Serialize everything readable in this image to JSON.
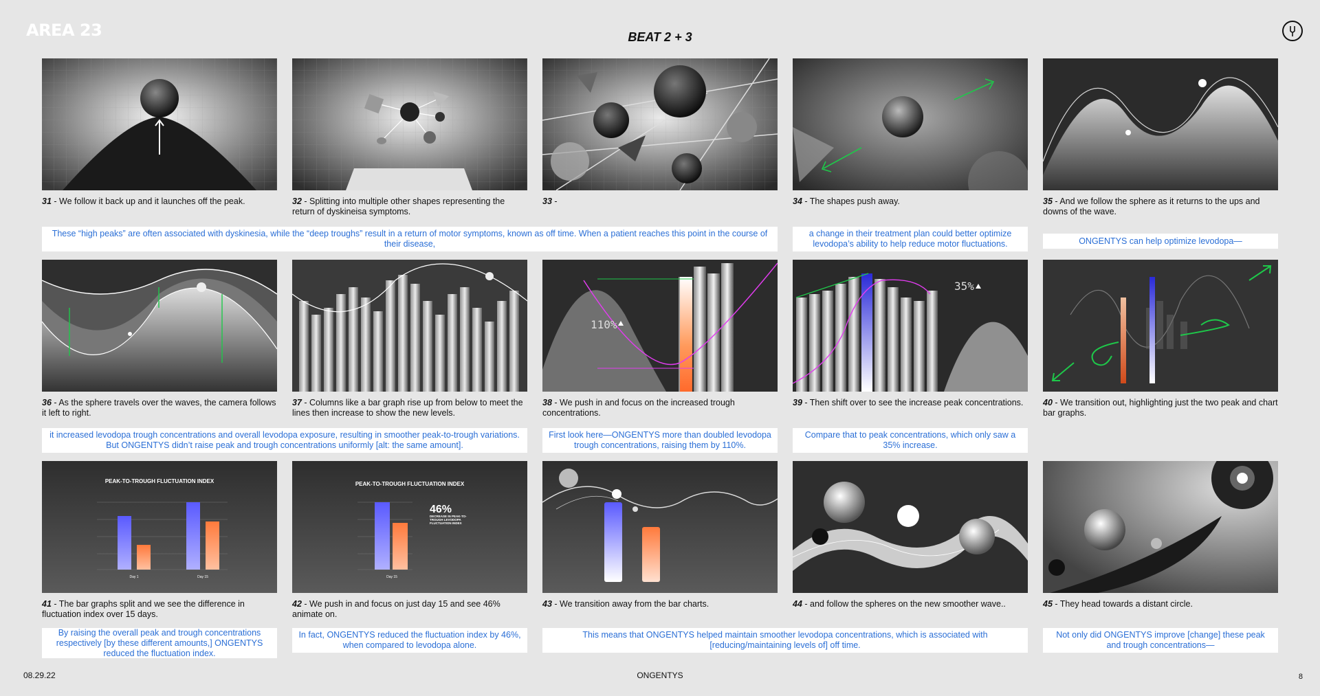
{
  "header": {
    "logo": "AREA 23",
    "title": "BEAT 2 + 3",
    "brandmark_icon": "tuning-fork-icon"
  },
  "colors": {
    "background": "#e6e6e6",
    "vo_text": "#2b6fd6",
    "accent_green": "#1ec94a",
    "accent_orange": "#ff7a3c",
    "accent_blue": "#2a2ad8",
    "accent_magenta": "#e23cf0"
  },
  "frames": [
    {
      "num": "31",
      "caption": "We follow it back up and it launches off the peak."
    },
    {
      "num": "32",
      "caption": "Splitting into multiple other shapes representing the return of dyskineisa symptoms."
    },
    {
      "num": "33",
      "caption": ""
    },
    {
      "num": "34",
      "caption": "The shapes push away."
    },
    {
      "num": "35",
      "caption": "And we follow the sphere as it returns to the ups and downs of the wave."
    },
    {
      "num": "36",
      "caption": "As the sphere travels over the waves, the camera follows it left to right."
    },
    {
      "num": "37",
      "caption": "Columns like a bar graph rise up from below to meet the lines then increase to show the new levels."
    },
    {
      "num": "38",
      "caption": "We push in and focus on the increased trough concentrations.",
      "overlay": "110%"
    },
    {
      "num": "39",
      "caption": "Then shift over to see the increase peak concentrations.",
      "overlay": "35%"
    },
    {
      "num": "40",
      "caption": "We transition out, highlighting just the two peak and chart bar graphs."
    },
    {
      "num": "41",
      "caption": "The bar graphs split and we see the difference in fluctuation index over 15 days.",
      "chart_title": "PEAK-TO-TROUGH FLUCTUATION INDEX",
      "chart_labels": [
        "Day 1",
        "Day 15"
      ]
    },
    {
      "num": "42",
      "caption": "We push in and focus on just day 15 and see 46% animate on.",
      "chart_title": "PEAK-TO-TROUGH FLUCTUATION INDEX",
      "big_number": "46%",
      "big_label": "DECREASE IN PEAK-TO-TROUGH LEVODOPA FLUCTUATION INDEX",
      "chart_labels": [
        "Day 15"
      ]
    },
    {
      "num": "43",
      "caption": "We transition away from the bar charts."
    },
    {
      "num": "44",
      "caption": "and follow the spheres on the new smoother wave.."
    },
    {
      "num": "45",
      "caption": "They head towards a distant circle."
    }
  ],
  "voiceovers": [
    "These “high peaks” are often associated with dyskinesia, while the “deep troughs” result in a return of motor symptoms, known as off time. When a patient reaches this point in the course of their disease,",
    "a change in their treatment plan could better optimize levodopa’s ability to help reduce motor fluctuations.",
    "ONGENTYS can help optimize levodopa—",
    "it increased levodopa trough concentrations and overall levodopa exposure, resulting in smoother peak-to-trough variations. But ONGENTYS didn’t raise peak and trough concentrations uniformly [alt: the same amount].",
    "First look here—ONGENTYS more than doubled levodopa trough concentrations, raising them by 110%.",
    "Compare that to peak concentrations, which only saw a 35% increase.",
    "By raising the overall peak and trough concentrations respectively [by these different amounts,] ONGENTYS reduced the fluctuation index.",
    "In fact, ONGENTYS reduced the fluctuation index by 46%, when compared to levodopa alone.",
    "This means that ONGENTYS helped maintain smoother levodopa concentrations, which is associated with [reducing/maintaining levels of] off time.",
    "Not only did ONGENTYS improve [change] these peak and trough concentrations—"
  ],
  "footer": {
    "date": "08.29.22",
    "brand": "ONGENTYS",
    "page": "8"
  }
}
